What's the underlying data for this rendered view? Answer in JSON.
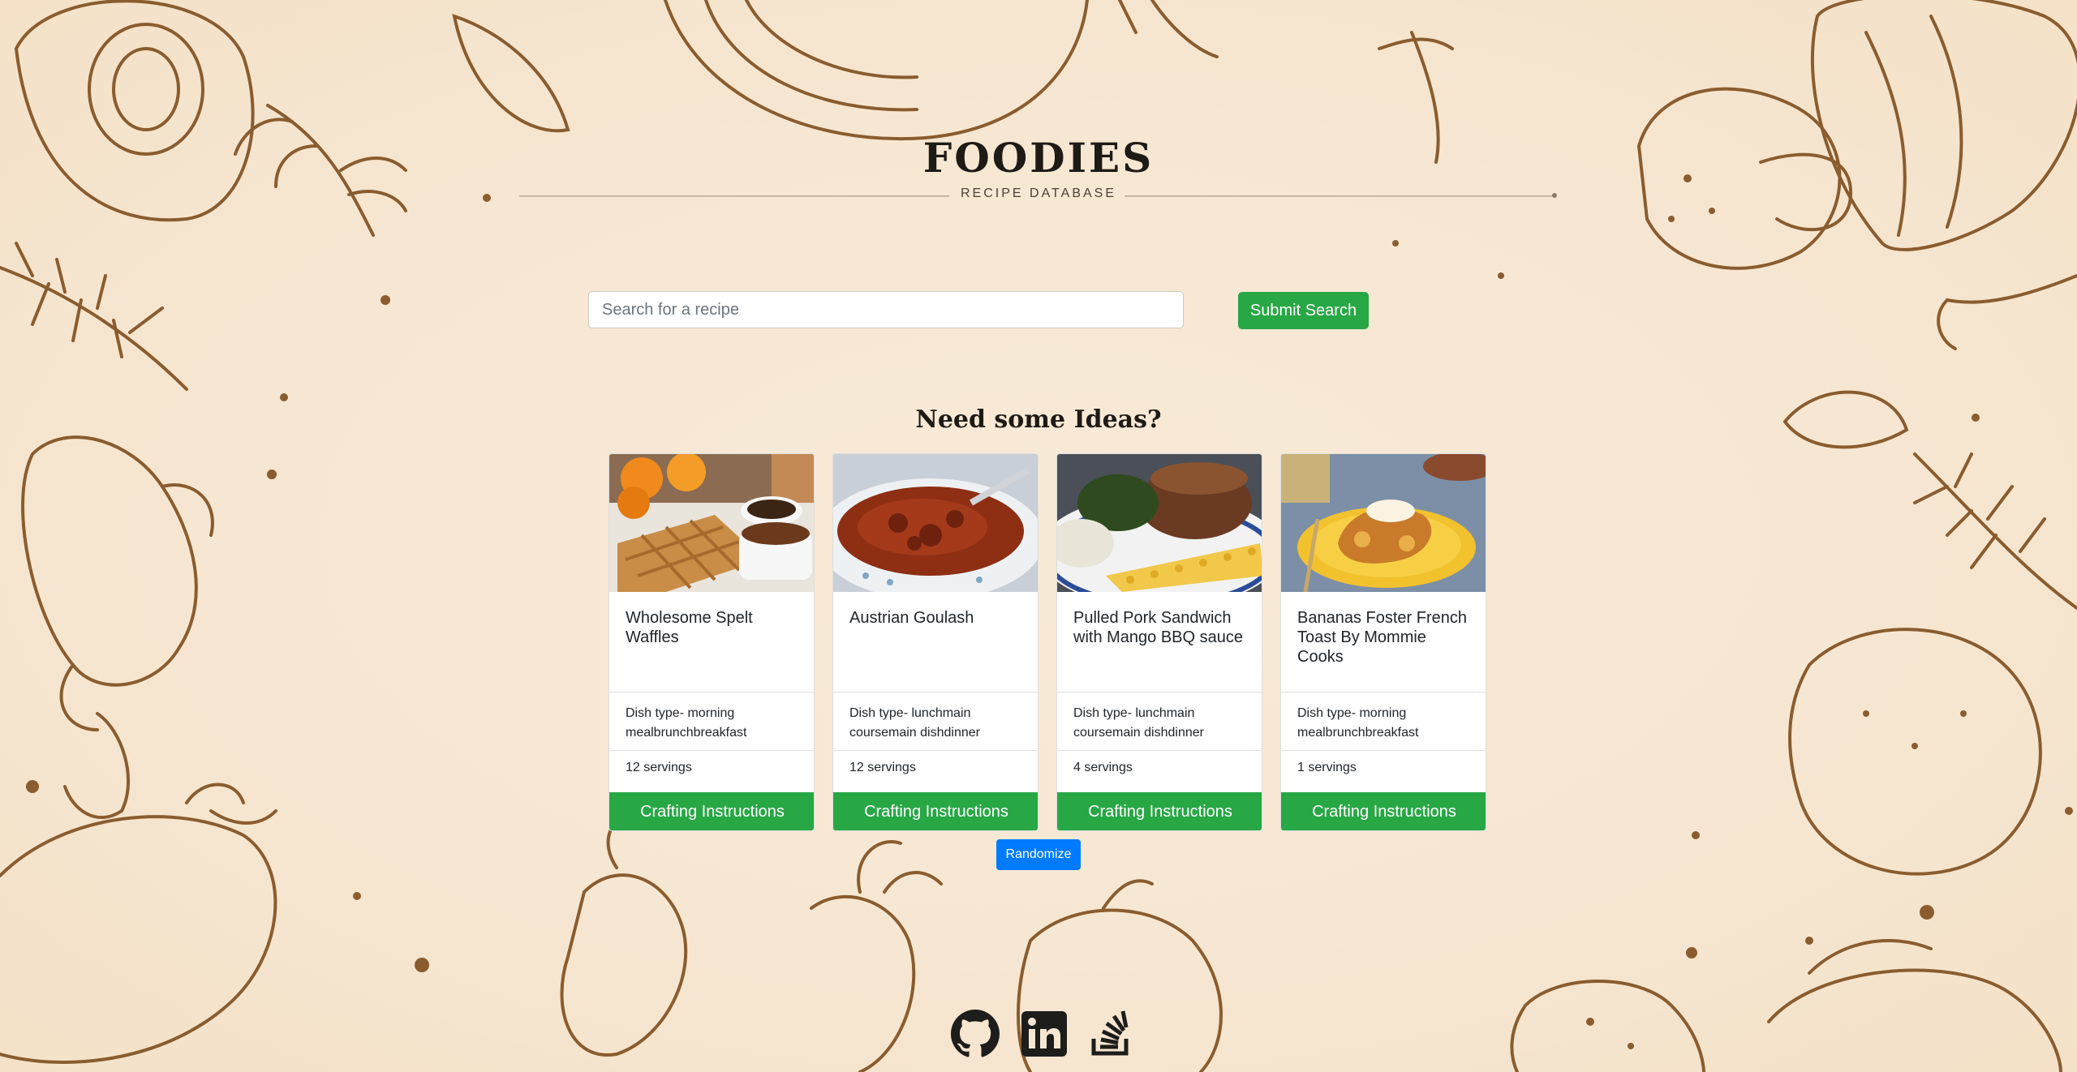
{
  "header": {
    "title": "FOODIES",
    "subtitle": "RECIPE DATABASE"
  },
  "search": {
    "placeholder": "Search for a recipe",
    "value": "",
    "submit_label": "Submit Search"
  },
  "ideas": {
    "heading": "Need some Ideas?",
    "cards": [
      {
        "title": "Wholesome Spelt Waffles",
        "dish_type": "Dish type- morning mealbrunchbreakfast",
        "servings": "12 servings",
        "button_label": "Crafting Instructions"
      },
      {
        "title": "Austrian Goulash",
        "dish_type": "Dish type- lunchmain coursemain dishdinner",
        "servings": "12 servings",
        "button_label": "Crafting Instructions"
      },
      {
        "title": "Pulled Pork Sandwich with Mango BBQ sauce",
        "dish_type": "Dish type- lunchmain coursemain dishdinner",
        "servings": "4 servings",
        "button_label": "Crafting Instructions"
      },
      {
        "title": "Bananas Foster French Toast By Mommie Cooks",
        "dish_type": "Dish type- morning mealbrunchbreakfast",
        "servings": "1 servings",
        "button_label": "Crafting Instructions"
      }
    ],
    "randomize_label": "Randomize"
  },
  "footer": {
    "icons": [
      "github-icon",
      "linkedin-icon",
      "stackoverflow-icon"
    ]
  },
  "colors": {
    "background": "#f6e7d2",
    "sketch": "#8a5c2e",
    "success": "#28a745",
    "primary": "#007bff"
  }
}
